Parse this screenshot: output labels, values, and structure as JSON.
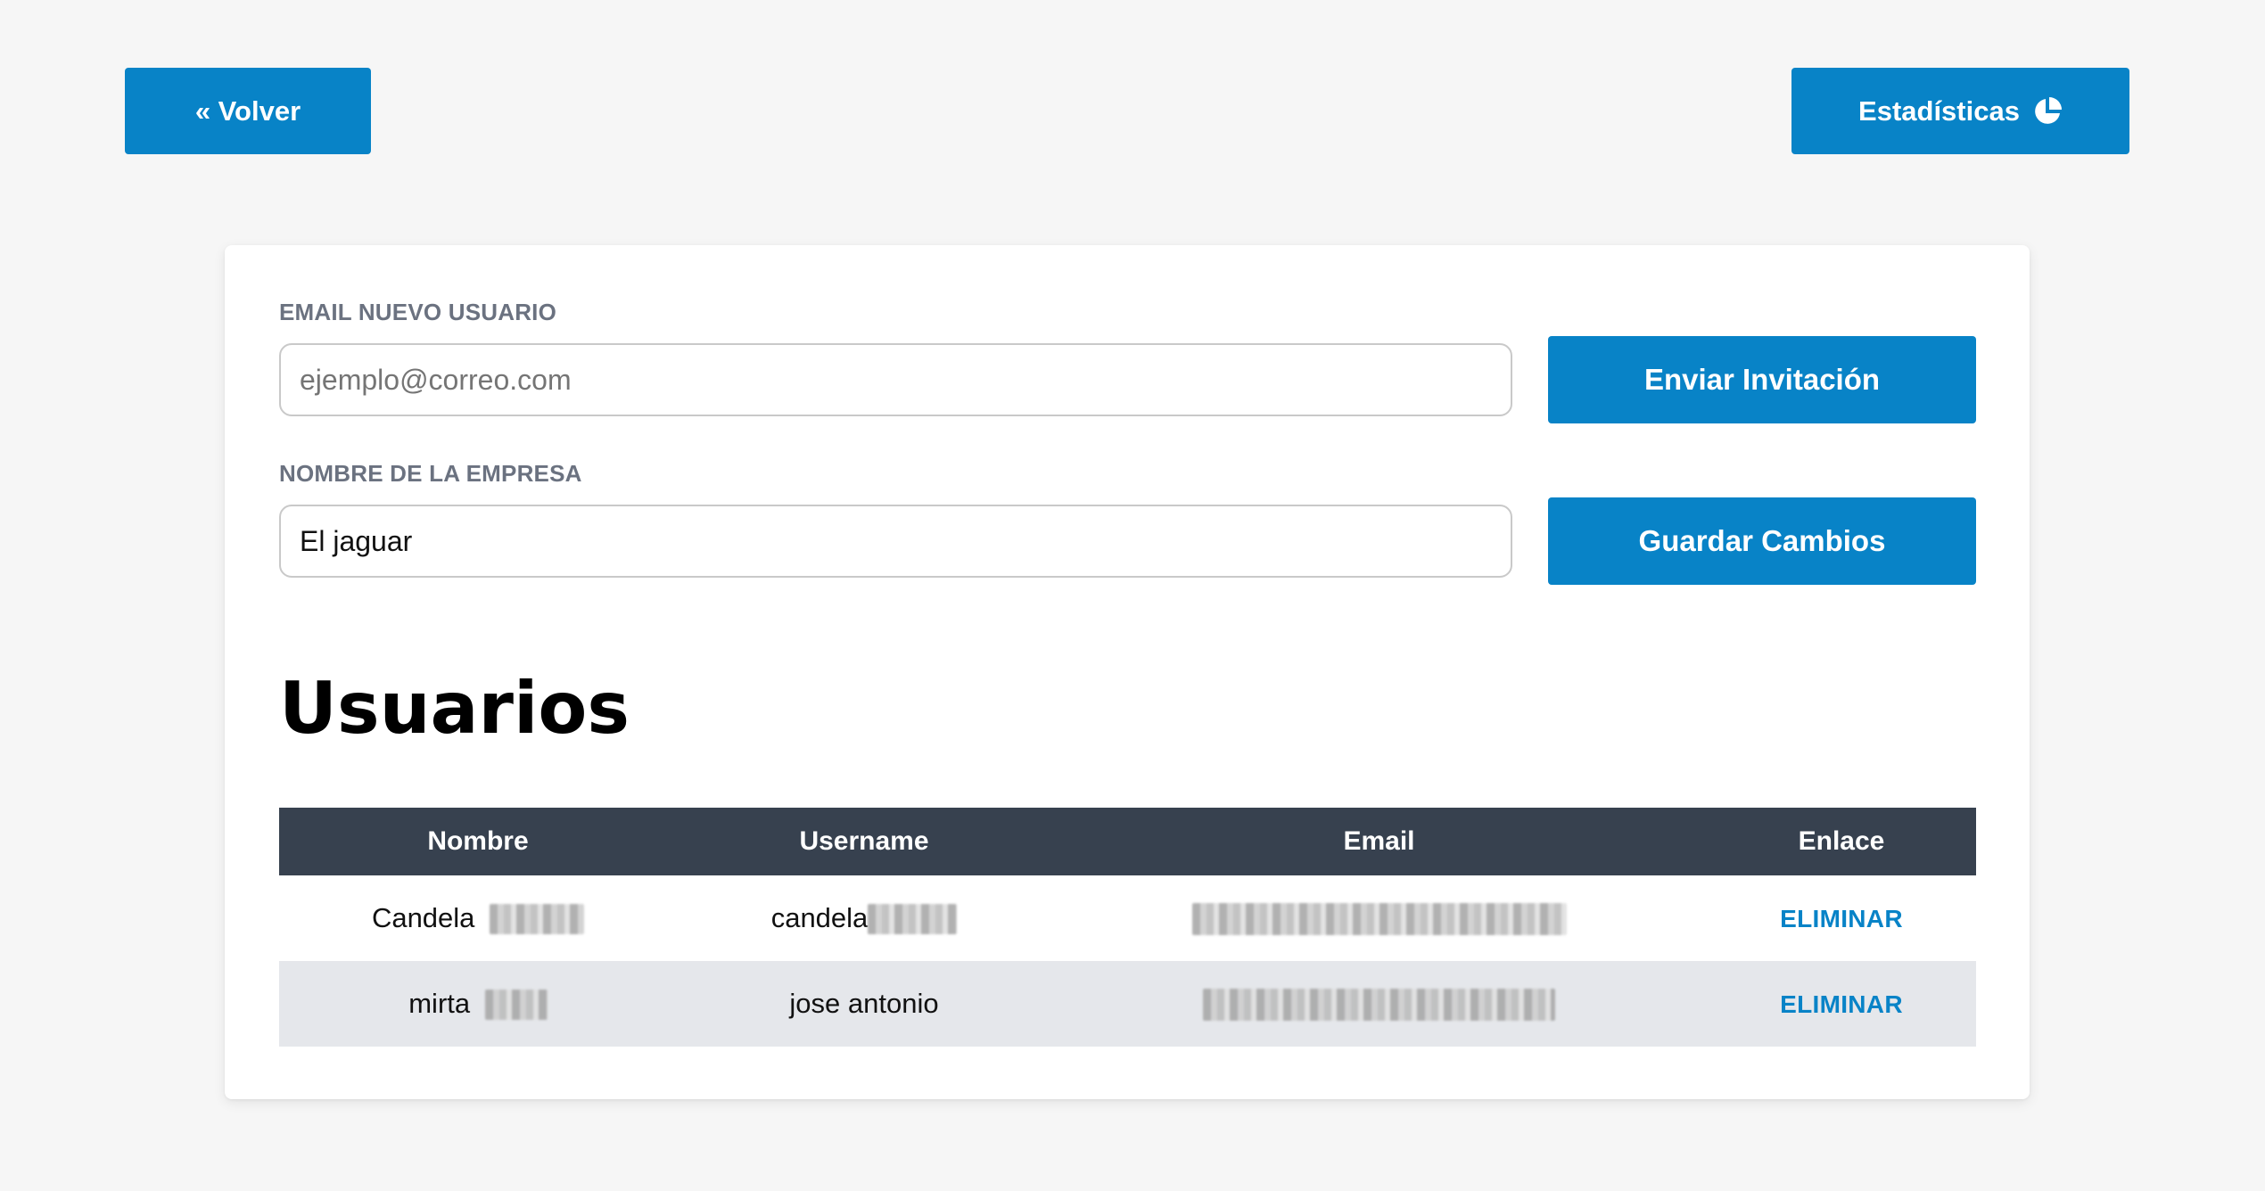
{
  "header": {
    "back_label": "« Volver",
    "stats_label": "Estadísticas",
    "stats_icon": "pie-chart-icon"
  },
  "form": {
    "email_label": "EMAIL NUEVO USUARIO",
    "email_placeholder": "ejemplo@correo.com",
    "email_value": "",
    "invite_label": "Enviar Invitación",
    "company_label": "NOMBRE DE LA EMPRESA",
    "company_value": "El jaguar",
    "save_label": "Guardar Cambios"
  },
  "users": {
    "title": "Usuarios",
    "columns": [
      "Nombre",
      "Username",
      "Email",
      "Enlace"
    ],
    "rows": [
      {
        "nombre": "Candela",
        "username": "candela",
        "email": "",
        "action": "ELIMINAR"
      },
      {
        "nombre": "mirta",
        "username": "jose antonio",
        "email": "",
        "action": "ELIMINAR"
      }
    ]
  },
  "colors": {
    "accent": "#0883c7",
    "table_header": "#37414f",
    "page_background": "#f6f6f6",
    "row_alt": "#e5e7eb"
  }
}
